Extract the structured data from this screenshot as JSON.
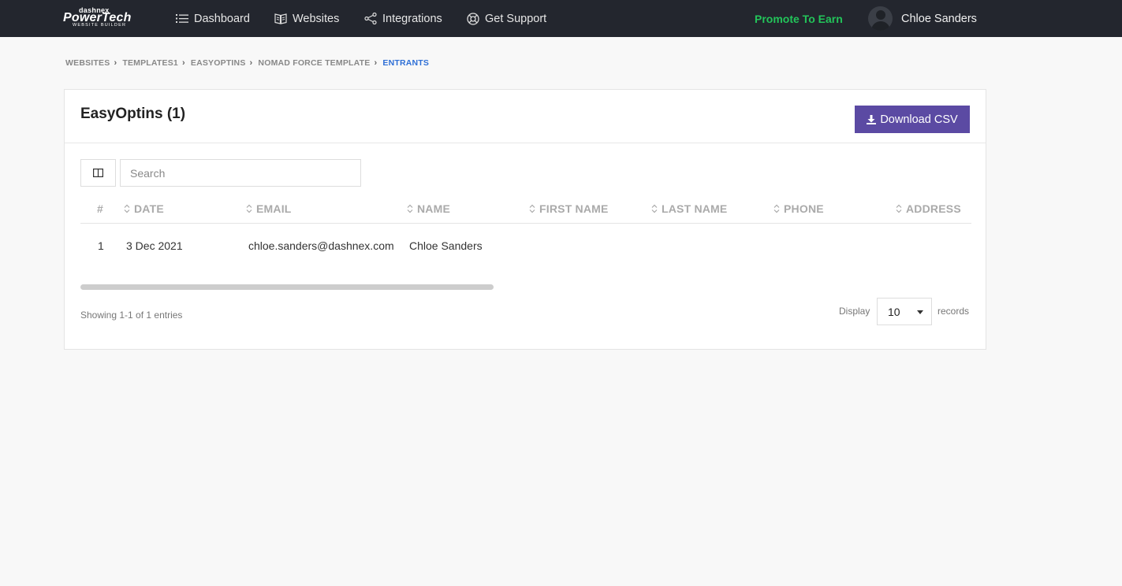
{
  "brand": {
    "top": "dashnex",
    "main": "PowerTech",
    "sub": "WEBSITE BUILDER"
  },
  "nav": {
    "dashboard": "Dashboard",
    "websites": "Websites",
    "integrations": "Integrations",
    "support": "Get Support",
    "promote": "Promote To Earn",
    "user_name": "Chloe Sanders"
  },
  "breadcrumb": [
    {
      "label": "WEBSITES"
    },
    {
      "label": "TEMPLATES1"
    },
    {
      "label": "EASYOPTINS"
    },
    {
      "label": "NOMAD FORCE TEMPLATE"
    },
    {
      "label": "ENTRANTS"
    }
  ],
  "card": {
    "title": "EasyOptins (1)",
    "download_label": "Download CSV"
  },
  "search": {
    "placeholder": "Search"
  },
  "table": {
    "columns": [
      "#",
      "DATE",
      "EMAIL",
      "NAME",
      "FIRST NAME",
      "LAST NAME",
      "PHONE",
      "ADDRESS"
    ],
    "rows": [
      {
        "num": "1",
        "date": "3 Dec 2021",
        "email": "chloe.sanders@dashnex.com",
        "name": "Chloe Sanders",
        "first_name": "",
        "last_name": "",
        "phone": "",
        "address": ""
      }
    ]
  },
  "footer": {
    "showing": "Showing 1-1 of 1 entries",
    "display_label": "Display",
    "page_size": "10",
    "records_label": "records"
  },
  "colors": {
    "topbar": "#23262e",
    "accent": "#5b4aa3",
    "promote": "#23c45a",
    "active_crumb": "#2e6fd6"
  }
}
